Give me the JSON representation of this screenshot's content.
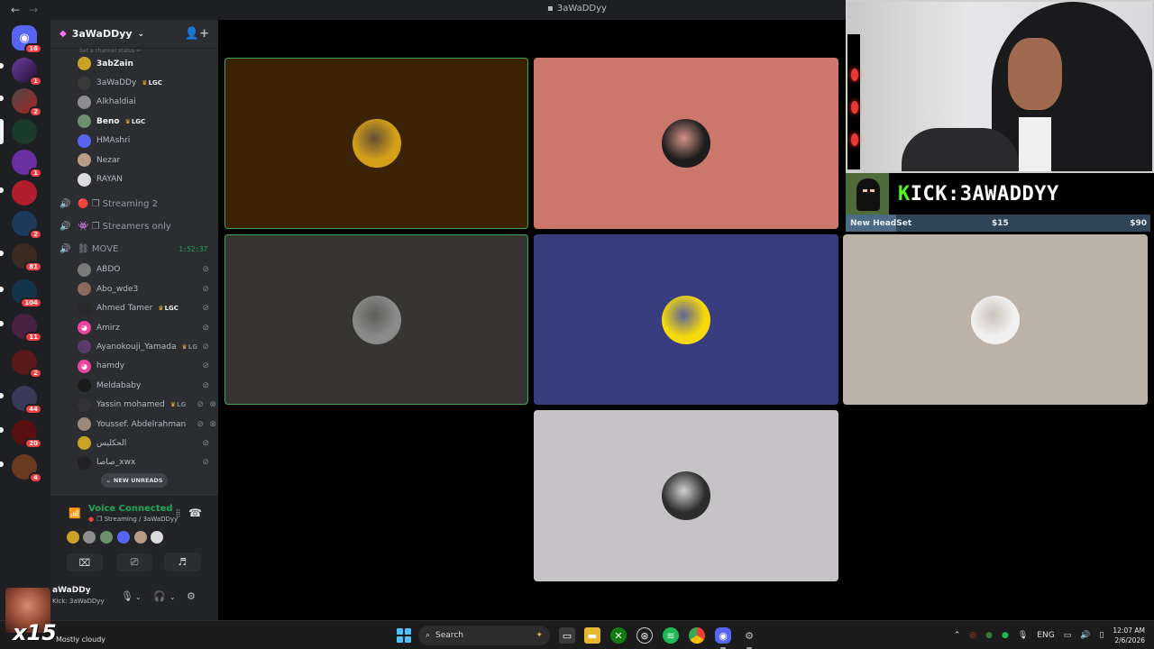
{
  "window": {
    "title": "3aWaDDyy",
    "back_arrow": "←",
    "forward_arrow": "→"
  },
  "server": {
    "name": "3aWaDDyy",
    "add_member_icon": "add-member-icon",
    "hint_text": "Set a channel status ✏"
  },
  "rail": {
    "badges": [
      "16",
      "1",
      "2",
      "1",
      "2",
      "81",
      "104",
      "11",
      "2",
      "44",
      "20",
      "4"
    ]
  },
  "members_top": [
    {
      "name": "3abZain",
      "bright": true,
      "tag": ""
    },
    {
      "name": "3aWaDDy",
      "bright": false,
      "tag": "LGC"
    },
    {
      "name": "Alkhaldiai",
      "bright": false,
      "tag": ""
    },
    {
      "name": "Beno",
      "bright": true,
      "tag": "LGC"
    },
    {
      "name": "HMAshri",
      "bright": false,
      "tag": ""
    },
    {
      "name": "Nezar",
      "bright": false,
      "tag": ""
    },
    {
      "name": "RAYAN",
      "bright": false,
      "tag": ""
    }
  ],
  "channels": [
    {
      "name": "🔴 ❐ Streaming 2",
      "active": false
    },
    {
      "name": "👾 ❐ Streamers only",
      "active": false
    },
    {
      "name": "⛓ MOVE",
      "active": true,
      "timer": "1:52:37"
    }
  ],
  "members_move": [
    {
      "name": "ABDO",
      "tag": "",
      "deaf": "deafened-icon",
      "deaf2": ""
    },
    {
      "name": "Abo_wde3",
      "tag": "",
      "deaf": "deafened-icon",
      "deaf2": ""
    },
    {
      "name": "Ahmed Tamer",
      "tag": "LGC",
      "deaf": "deafened-icon",
      "deaf2": ""
    },
    {
      "name": "Amirz",
      "tag": "",
      "deaf": "deafened-icon",
      "deaf2": ""
    },
    {
      "name": "Ayanokouji_Yamada",
      "tag": "LG",
      "deaf": "deafened-icon",
      "deaf2": ""
    },
    {
      "name": "hamdy",
      "tag": "",
      "deaf": "deafened-icon",
      "deaf2": ""
    },
    {
      "name": "Meldababy",
      "tag": "",
      "deaf": "deafened-icon",
      "deaf2": ""
    },
    {
      "name": "Yassin mohamed",
      "tag": "LG",
      "deaf": "deafened-icon",
      "deaf2": "camera-off-icon"
    },
    {
      "name": "Youssef. Abdelrahman",
      "tag": "",
      "deaf": "deafened-icon",
      "deaf2": "camera-off-icon"
    },
    {
      "name": "الحكليس",
      "tag": "",
      "deaf": "deafened-icon",
      "deaf2": ""
    },
    {
      "name": "صاصا_xwx",
      "tag": "",
      "deaf": "deafened-icon",
      "deaf2": ""
    }
  ],
  "new_unreads": "NEW UNREADS",
  "voice": {
    "status": "Voice Connected",
    "channel": "❐ Streaming / 3aWaDDyy",
    "camera_label": "Turn On Camera",
    "screen_label": "Share Screen",
    "activity_label": "Activities",
    "soundboard_label": "Soundboard"
  },
  "user": {
    "name": "aWaDDy",
    "status": "Kick: 3aWaDDyy",
    "overlay_badge": "x15"
  },
  "weather": "Mostly cloudy",
  "stream_overlay": {
    "kick_prefix": "K",
    "kick_rest": "ICK:3AWADDYY",
    "goal_name": "New HeadSet",
    "goal_current": "$15",
    "goal_target": "$90",
    "goal_progress": 0.167
  },
  "tiles": [
    {
      "bg": "#3b2204",
      "avatar": "#d4a017",
      "speaking": true
    },
    {
      "bg": "#cb776b",
      "avatar": "#1d1d1d",
      "speaking": false
    },
    {
      "bg": "#363532",
      "avatar": "#8a8a8a",
      "speaking": true
    },
    {
      "bg": "#383d7f",
      "avatar": "#f5d90a",
      "speaking": false
    },
    {
      "bg": "#bdb2a8",
      "avatar": "#f1f1f1",
      "speaking": false
    },
    {
      "bg": "#c5c3c6",
      "avatar": "#2c2c2c",
      "speaking": false
    }
  ],
  "taskbar": {
    "search_placeholder": "Search",
    "language": "ENG",
    "time": "12:07 AM",
    "date": "2/6/2026"
  },
  "colors": {
    "green": "#23a55a",
    "kick_green": "#53fc18",
    "discord_bg": "#2b2d31"
  }
}
